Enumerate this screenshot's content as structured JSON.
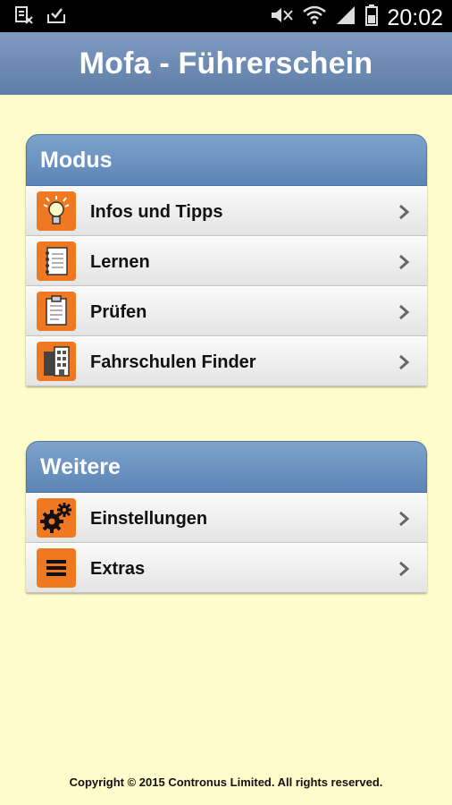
{
  "statusbar": {
    "time": "20:02",
    "icons": [
      "document-x-icon",
      "inbox-check-icon",
      "mute-icon",
      "wifi-icon",
      "signal-icon",
      "battery-icon"
    ]
  },
  "app": {
    "title": "Mofa - Führerschein"
  },
  "modus": {
    "title": "Modus",
    "items": [
      {
        "label": "Infos und Tipps",
        "icon": "lightbulb-icon"
      },
      {
        "label": "Lernen",
        "icon": "notebook-icon"
      },
      {
        "label": "Prüfen",
        "icon": "clipboard-icon"
      },
      {
        "label": "Fahrschulen Finder",
        "icon": "building-icon"
      }
    ]
  },
  "weitere": {
    "title": "Weitere",
    "items": [
      {
        "label": "Einstellungen",
        "icon": "gears-icon"
      },
      {
        "label": "Extras",
        "icon": "menu-icon"
      }
    ]
  },
  "footer": {
    "copyright": "Copyright © 2015 Contronus Limited. All rights reserved."
  },
  "colors": {
    "background": "#fffccb",
    "appbar": "#6b88b0",
    "accent": "#f07820",
    "header": "#6a91c0"
  }
}
